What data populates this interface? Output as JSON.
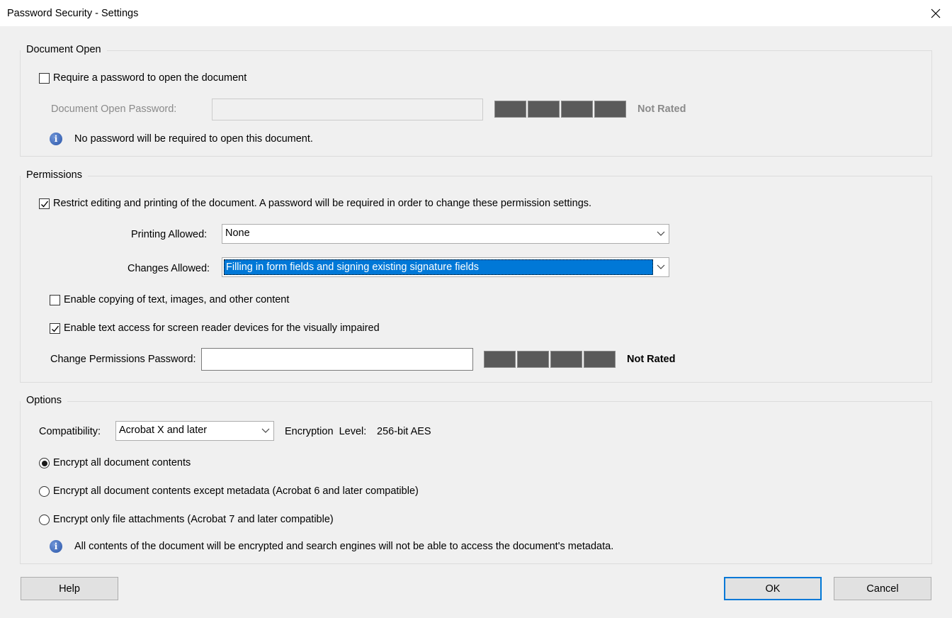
{
  "window": {
    "title": "Password Security - Settings",
    "close_glyph": "✕"
  },
  "document_open": {
    "legend": "Document Open",
    "require_password_label": "Require a password to open the document",
    "require_password_checked": false,
    "password_label": "Document Open Password:",
    "password_value": "",
    "strength_rating": "Not Rated",
    "info_text": "No password will be required to open this document."
  },
  "permissions": {
    "legend": "Permissions",
    "restrict_label": "Restrict editing and printing of the document. A password will be required in order to change these permission settings.",
    "restrict_checked": true,
    "printing_label": "Printing Allowed:",
    "printing_value": "None",
    "changes_label": "Changes Allowed:",
    "changes_value": "Filling in form fields and signing existing signature fields",
    "enable_copying_label": "Enable copying of text, images, and other content",
    "enable_copying_checked": false,
    "enable_screen_reader_label": "Enable text access for screen reader devices for the visually impaired",
    "enable_screen_reader_checked": true,
    "change_password_label": "Change Permissions Password:",
    "change_password_value": "",
    "strength_rating": "Not Rated"
  },
  "options": {
    "legend": "Options",
    "compatibility_label": "Compatibility:",
    "compatibility_value": "Acrobat X and later",
    "encryption_level_label": "Encryption  Level:",
    "encryption_level_value": "256-bit AES",
    "radio_all": "Encrypt all document contents",
    "radio_except_metadata": "Encrypt all document contents except metadata (Acrobat 6 and later compatible)",
    "radio_attachments": "Encrypt only file attachments (Acrobat 7 and later compatible)",
    "selected_radio": "all",
    "info_text": "All contents of the document will be encrypted and search engines will not be able to access the document's metadata."
  },
  "buttons": {
    "help": "Help",
    "ok": "OK",
    "cancel": "Cancel"
  },
  "icons": {
    "info": "info-icon",
    "check": "checkmark-icon",
    "dropdown": "chevron-down-icon",
    "close": "close-icon"
  },
  "colors": {
    "selection": "#0078d7",
    "meter": "#5a5a5a",
    "info_icon": "#3c6ab8"
  }
}
